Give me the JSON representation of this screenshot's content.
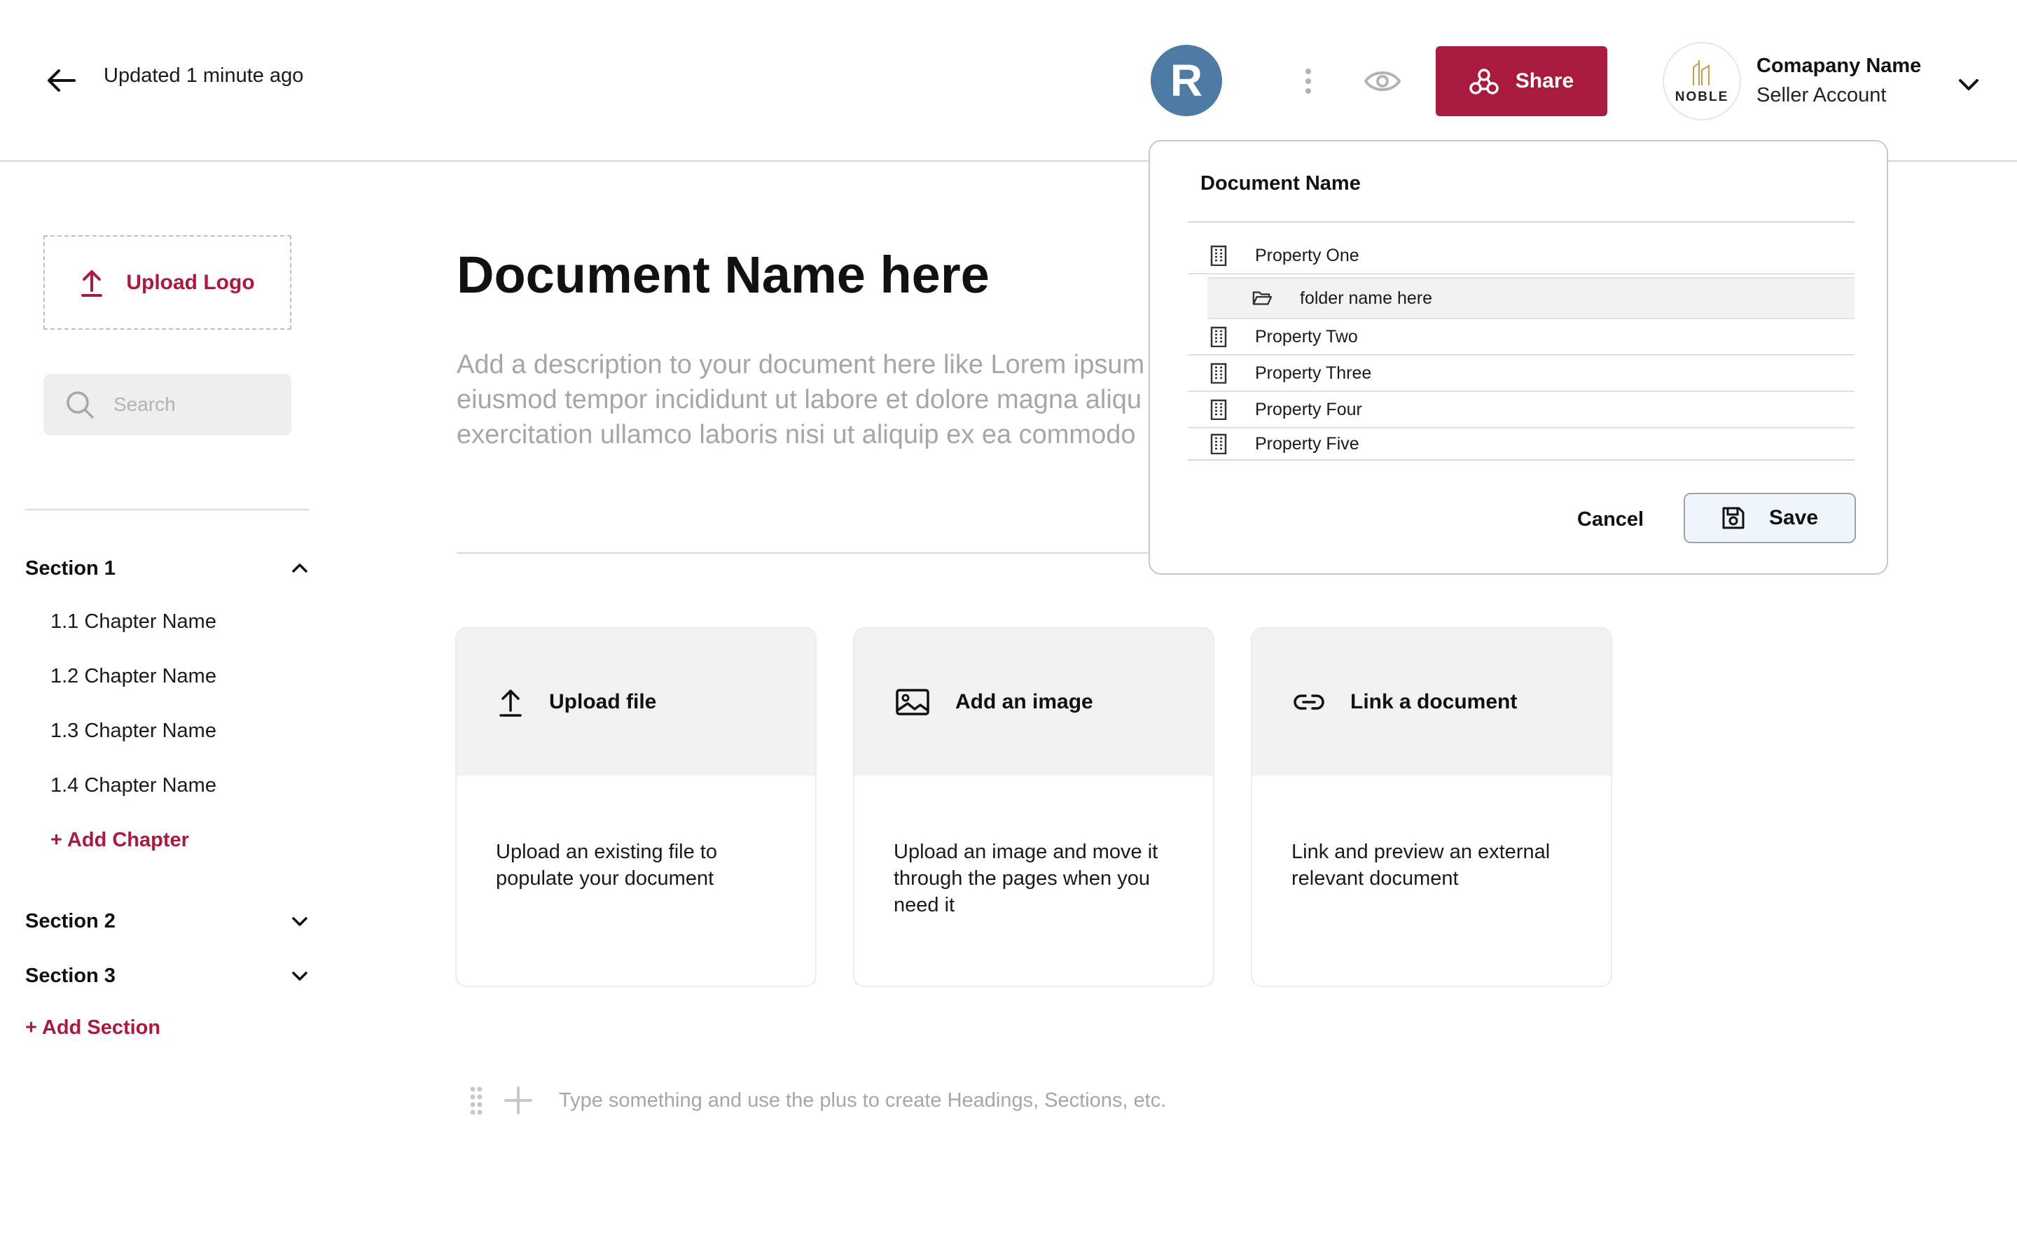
{
  "header": {
    "updated_text": "Updated 1 minute ago",
    "avatar_initial": "R",
    "share_label": "Share",
    "company_logo_text": "NOBLE",
    "company_name": "Comapany Name",
    "account_type": "Seller Account",
    "accent_color": "#a81b3e",
    "avatar_color": "#4e7ba4"
  },
  "sidebar": {
    "upload_logo_label": "Upload Logo",
    "search_placeholder": "Search",
    "sections": [
      {
        "name": "Section 1",
        "expanded": true,
        "chapters": [
          "1.1 Chapter Name",
          "1.2 Chapter Name",
          "1.3 Chapter Name",
          "1.4 Chapter Name"
        ],
        "add_chapter_label": "+ Add Chapter"
      },
      {
        "name": "Section 2",
        "expanded": false
      },
      {
        "name": "Section 3",
        "expanded": false
      }
    ],
    "add_section_label": "+ Add Section"
  },
  "main": {
    "title": "Document Name here",
    "description_lines": [
      "Add a description to your document here like Lorem ipsum",
      "eiusmod tempor incididunt ut labore et dolore magna aliqu",
      "exercitation ullamco laboris nisi ut aliquip ex ea commodo"
    ],
    "cards": [
      {
        "icon": "upload-icon",
        "title": "Upload file",
        "body": "Upload an existing file to populate your document"
      },
      {
        "icon": "image-icon",
        "title": "Add an image",
        "body": "Upload an image and move it through the pages when you need it"
      },
      {
        "icon": "link-icon",
        "title": "Link a document",
        "body": "Link and preview an external relevant document"
      }
    ],
    "editor_hint": "Type something and use the plus to create Headings, Sections, etc."
  },
  "save_popover": {
    "title": "Document Name",
    "items": [
      {
        "icon": "building-icon",
        "label": "Property One"
      },
      {
        "icon": "folder-icon",
        "label": "folder name here",
        "nested": true,
        "selected": true
      },
      {
        "icon": "building-icon",
        "label": "Property Two"
      },
      {
        "icon": "building-icon",
        "label": "Property Three"
      },
      {
        "icon": "building-icon",
        "label": "Property Four"
      },
      {
        "icon": "building-icon",
        "label": "Property Five"
      }
    ],
    "cancel_label": "Cancel",
    "save_label": "Save"
  }
}
